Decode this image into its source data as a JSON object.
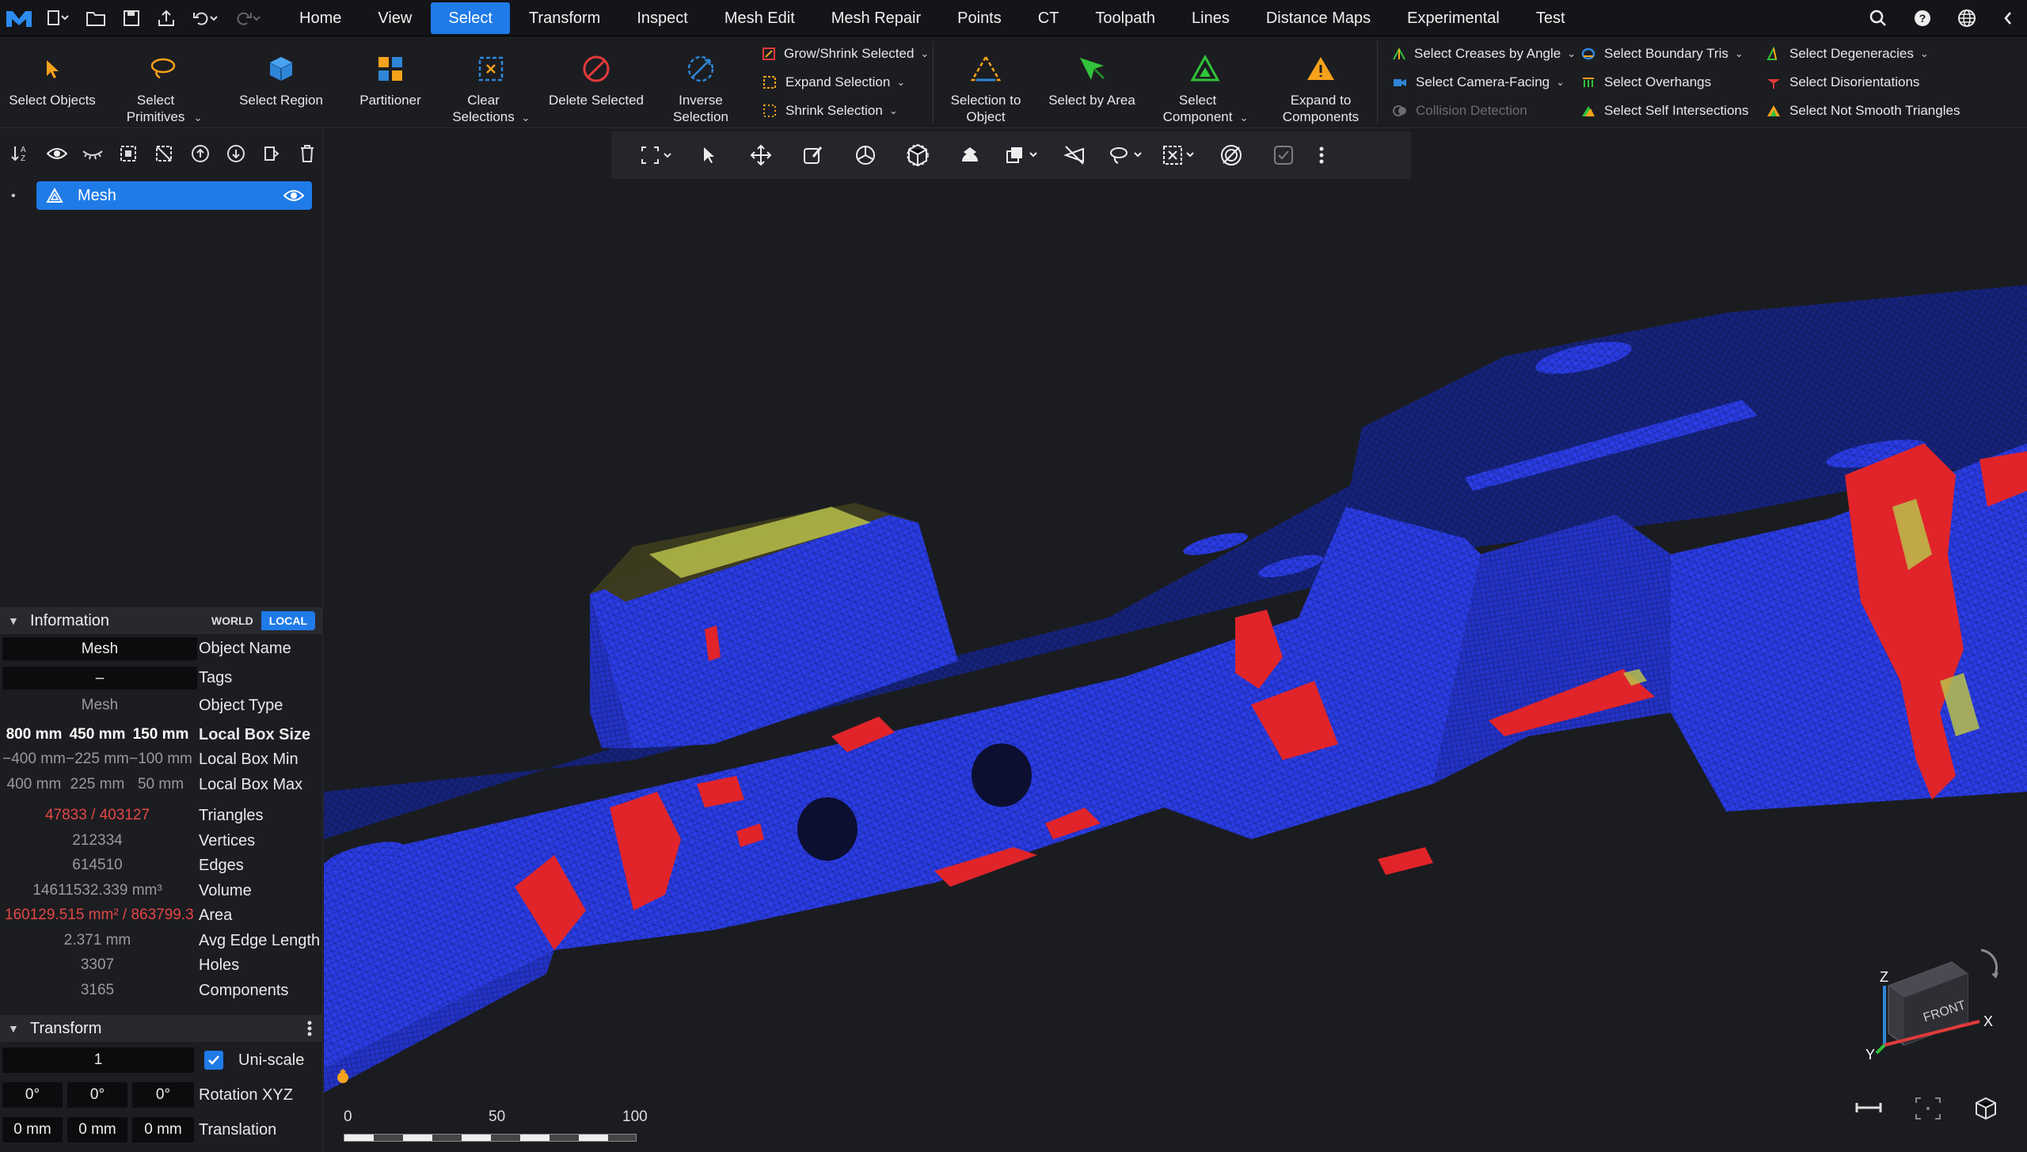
{
  "menubar": {
    "tabs": [
      "Home",
      "View",
      "Select",
      "Transform",
      "Inspect",
      "Mesh Edit",
      "Mesh Repair",
      "Points",
      "CT",
      "Toolpath",
      "Lines",
      "Distance Maps",
      "Experimental",
      "Test"
    ],
    "active_tab": "Select"
  },
  "ribbon": {
    "select_objects": "Select Objects",
    "select_primitives": "Select Primitives",
    "select_region": "Select Region",
    "partitioner": "Partitioner",
    "clear_selections": "Clear Selections",
    "delete_selected": "Delete Selected",
    "inverse_selection": "Inverse Selection",
    "grow_shrink": "Grow/Shrink Selected",
    "expand_selection": "Expand Selection",
    "shrink_selection": "Shrink Selection",
    "selection_to_object": "Selection to Object",
    "select_by_area": "Select by Area",
    "select_component": "Select Component",
    "expand_to_components": "Expand to Components",
    "select_creases": "Select Creases by Angle",
    "select_camera_facing": "Select Camera-Facing",
    "collision_detection": "Collision Detection",
    "select_boundary_tris": "Select Boundary Tris",
    "select_overhangs": "Select Overhangs",
    "select_self_intersections": "Select Self Intersections",
    "select_degeneracies": "Select Degeneracies",
    "select_disorientations": "Select Disorientations",
    "select_not_smooth": "Select Not Smooth Triangles"
  },
  "tree": {
    "item": "Mesh"
  },
  "information": {
    "title": "Information",
    "world": "WORLD",
    "local": "LOCAL",
    "object_name": {
      "value": "Mesh",
      "label": "Object Name"
    },
    "tags": {
      "value": "–",
      "label": "Tags"
    },
    "object_type": {
      "value": "Mesh",
      "label": "Object Type"
    },
    "box_size": {
      "x": "800 mm",
      "y": "450 mm",
      "z": "150 mm",
      "label": "Local Box Size"
    },
    "box_min": {
      "x": "−400 mm",
      "y": "−225 mm",
      "z": "−100 mm",
      "label": "Local Box Min"
    },
    "box_max": {
      "x": "400 mm",
      "y": "225 mm",
      "z": "50 mm",
      "label": "Local Box Max"
    },
    "triangles": {
      "value": "47833 / 403127",
      "label": "Triangles"
    },
    "vertices": {
      "value": "212334",
      "label": "Vertices"
    },
    "edges": {
      "value": "614510",
      "label": "Edges"
    },
    "volume": {
      "value": "14611532.339 mm³",
      "label": "Volume"
    },
    "area": {
      "value": "160129.515 mm² / 863799.3",
      "label": "Area"
    },
    "avg_edge": {
      "value": "2.371 mm",
      "label": "Avg Edge Length"
    },
    "holes": {
      "value": "3307",
      "label": "Holes"
    },
    "components": {
      "value": "3165",
      "label": "Components"
    }
  },
  "transform": {
    "title": "Transform",
    "scale": "1",
    "uniscale": "Uni-scale",
    "rot": {
      "x": "0°",
      "y": "0°",
      "z": "0°",
      "label": "Rotation XYZ"
    },
    "trans": {
      "x": "0 mm",
      "y": "0 mm",
      "z": "0 mm",
      "label": "Translation"
    }
  },
  "scalebar": {
    "t0": "0",
    "t1": "50",
    "t2": "100"
  },
  "gizmo": {
    "z": "Z",
    "y": "Y",
    "x": "X",
    "face": "FRONT"
  },
  "colors": {
    "accent": "#1f7be8",
    "mesh_blue": "#2f3fe0",
    "mesh_red": "#e0242a",
    "mesh_yellow": "#d9d24a",
    "error": "#e34747"
  }
}
